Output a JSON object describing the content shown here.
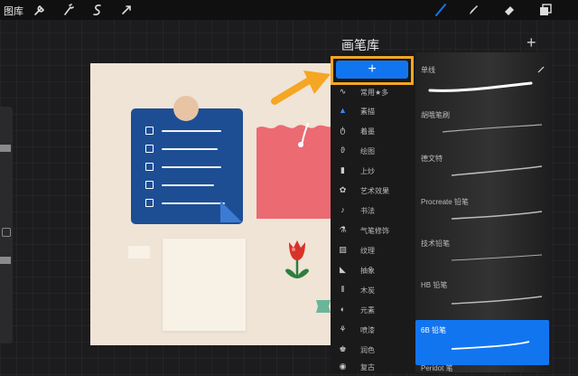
{
  "toolbar": {
    "gallery_label": "图库",
    "tools": [
      {
        "name": "actions-icon"
      },
      {
        "name": "adjustments-icon"
      },
      {
        "name": "selection-icon"
      },
      {
        "name": "transform-icon"
      }
    ],
    "right_tools": [
      {
        "name": "brush-icon",
        "active": true
      },
      {
        "name": "smudge-icon"
      },
      {
        "name": "eraser-icon"
      },
      {
        "name": "layers-icon"
      }
    ],
    "accent_color": "#1275f0"
  },
  "brush_library": {
    "title": "画笔库",
    "add_button": "+",
    "new_set_button": "+",
    "highlight_color": "#f5a623",
    "categories": [
      {
        "label": "常用★多",
        "icon": "stroke-icon",
        "active": false
      },
      {
        "label": "素描",
        "icon": "triangle-icon",
        "active": true
      },
      {
        "label": "着墨",
        "icon": "ink-drop-icon",
        "active": false
      },
      {
        "label": "绘图",
        "icon": "swirl-icon",
        "active": false
      },
      {
        "label": "上炒",
        "icon": "brush-pen-icon",
        "active": false
      },
      {
        "label": "艺术效果",
        "icon": "palette-icon",
        "active": false
      },
      {
        "label": "书法",
        "icon": "calligraphy-icon",
        "active": false
      },
      {
        "label": "气笔修饰",
        "icon": "airbrush-icon",
        "active": false
      },
      {
        "label": "纹理",
        "icon": "texture-icon",
        "active": false
      },
      {
        "label": "抽象",
        "icon": "abstract-icon",
        "active": false
      },
      {
        "label": "木炭",
        "icon": "charcoal-icon",
        "active": false
      },
      {
        "label": "元素",
        "icon": "yin-yang-icon",
        "active": false
      },
      {
        "label": "喷漆",
        "icon": "spray-icon",
        "active": false
      },
      {
        "label": "润色",
        "icon": "touchup-icon",
        "active": false
      },
      {
        "label": "复古",
        "icon": "retro-icon",
        "active": false
      }
    ],
    "brushes": [
      {
        "name": "单线",
        "selected": false
      },
      {
        "name": "胡哦笔刷",
        "selected": false
      },
      {
        "name": "德文特",
        "selected": false
      },
      {
        "name": "Procreate 铅笔",
        "selected": false
      },
      {
        "name": "技术铅笔",
        "selected": false
      },
      {
        "name": "HB 铅笔",
        "selected": false
      },
      {
        "name": "6B 铅笔",
        "selected": true
      },
      {
        "name": "Peridot 笔",
        "selected": false
      }
    ]
  },
  "canvas": {
    "background": "#efe4d6",
    "notepad_color": "#1d4e94",
    "pink_card_color": "#ec6a72",
    "tulip_color": "#d9322b"
  }
}
